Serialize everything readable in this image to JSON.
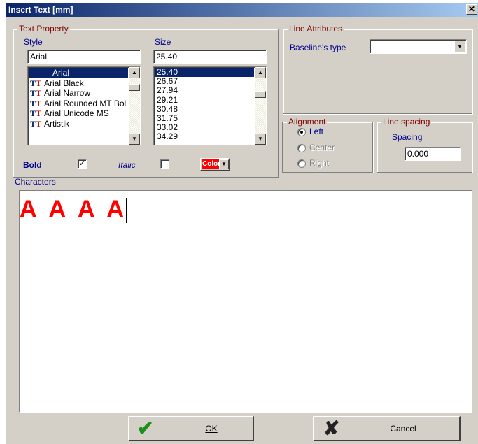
{
  "window": {
    "title": "Insert Text  [mm]",
    "close_glyph": "✕"
  },
  "text_property": {
    "legend": "Text Property",
    "style_label": "Style",
    "size_label": "Size",
    "style_value": "Arial",
    "size_value": "25.40",
    "fonts": [
      "Arial",
      "Arial Black",
      "Arial Narrow",
      "Arial Rounded MT Bol",
      "Arial Unicode MS",
      "Artistik"
    ],
    "sizes": [
      "25.40",
      "26.67",
      "27.94",
      "29.21",
      "30.48",
      "31.75",
      "33.02",
      "34.29"
    ],
    "bold_label": "Bold",
    "bold_checked": true,
    "italic_label": "Italic",
    "italic_checked": false,
    "color_label": "Color",
    "color_value": "#ff0000"
  },
  "line_attributes": {
    "legend": "Line Attributes",
    "baseline_label": "Baseline's type",
    "baseline_value": ""
  },
  "alignment": {
    "legend": "Alignment",
    "options": [
      "Left",
      "Center",
      "Right"
    ],
    "selected": "Left"
  },
  "line_spacing": {
    "legend": "Line spacing",
    "spacing_label": "Spacing",
    "spacing_value": "0.000"
  },
  "characters": {
    "label": "Characters",
    "content": "A A A A"
  },
  "buttons": {
    "ok_label": "OK",
    "cancel_label": "Cancel"
  },
  "icons": {
    "ok": "checkmark-icon",
    "cancel": "x-icon",
    "font": "truetype-font-icon",
    "scroll_up": "arrow-up-icon",
    "scroll_down": "arrow-down-icon",
    "dropdown": "chevron-down-icon"
  }
}
